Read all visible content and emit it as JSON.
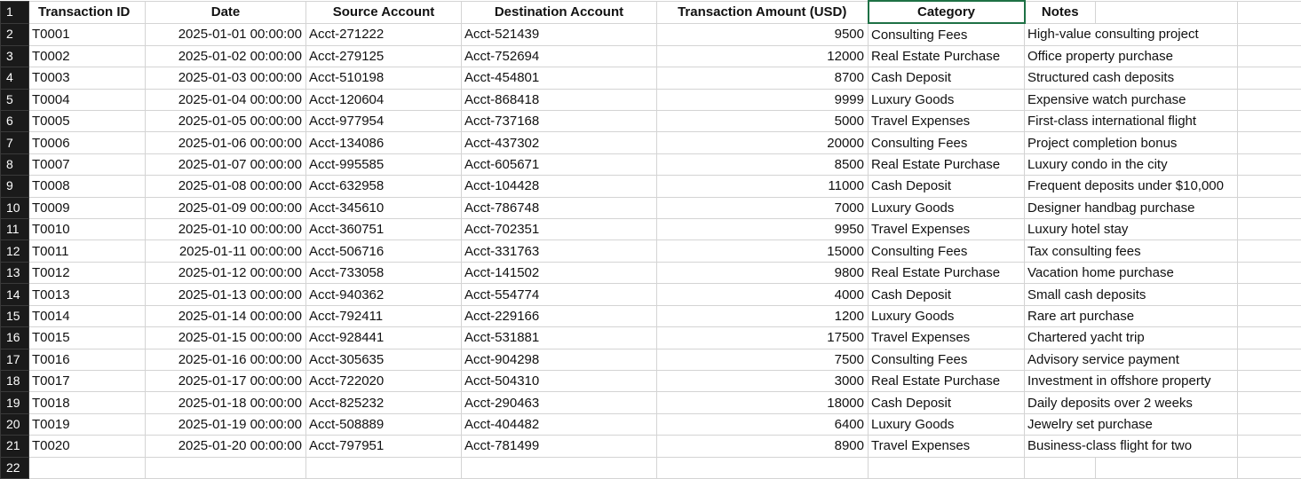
{
  "headers": [
    "Transaction ID",
    "Date",
    "Source Account",
    "Destination Account",
    "Transaction Amount (USD)",
    "Category",
    "Notes"
  ],
  "rows": [
    [
      "T0001",
      "2025-01-01 00:00:00",
      "Acct-271222",
      "Acct-521439",
      "9500",
      "Consulting Fees",
      "High-value consulting project"
    ],
    [
      "T0002",
      "2025-01-02 00:00:00",
      "Acct-279125",
      "Acct-752694",
      "12000",
      "Real Estate Purchase",
      "Office property purchase"
    ],
    [
      "T0003",
      "2025-01-03 00:00:00",
      "Acct-510198",
      "Acct-454801",
      "8700",
      "Cash Deposit",
      "Structured cash deposits"
    ],
    [
      "T0004",
      "2025-01-04 00:00:00",
      "Acct-120604",
      "Acct-868418",
      "9999",
      "Luxury Goods",
      "Expensive watch purchase"
    ],
    [
      "T0005",
      "2025-01-05 00:00:00",
      "Acct-977954",
      "Acct-737168",
      "5000",
      "Travel Expenses",
      "First-class international flight"
    ],
    [
      "T0006",
      "2025-01-06 00:00:00",
      "Acct-134086",
      "Acct-437302",
      "20000",
      "Consulting Fees",
      "Project completion bonus"
    ],
    [
      "T0007",
      "2025-01-07 00:00:00",
      "Acct-995585",
      "Acct-605671",
      "8500",
      "Real Estate Purchase",
      "Luxury condo in the city"
    ],
    [
      "T0008",
      "2025-01-08 00:00:00",
      "Acct-632958",
      "Acct-104428",
      "11000",
      "Cash Deposit",
      "Frequent deposits under $10,000"
    ],
    [
      "T0009",
      "2025-01-09 00:00:00",
      "Acct-345610",
      "Acct-786748",
      "7000",
      "Luxury Goods",
      "Designer handbag purchase"
    ],
    [
      "T0010",
      "2025-01-10 00:00:00",
      "Acct-360751",
      "Acct-702351",
      "9950",
      "Travel Expenses",
      "Luxury hotel stay"
    ],
    [
      "T0011",
      "2025-01-11 00:00:00",
      "Acct-506716",
      "Acct-331763",
      "15000",
      "Consulting Fees",
      "Tax consulting fees"
    ],
    [
      "T0012",
      "2025-01-12 00:00:00",
      "Acct-733058",
      "Acct-141502",
      "9800",
      "Real Estate Purchase",
      "Vacation home purchase"
    ],
    [
      "T0013",
      "2025-01-13 00:00:00",
      "Acct-940362",
      "Acct-554774",
      "4000",
      "Cash Deposit",
      "Small cash deposits"
    ],
    [
      "T0014",
      "2025-01-14 00:00:00",
      "Acct-792411",
      "Acct-229166",
      "1200",
      "Luxury Goods",
      "Rare art purchase"
    ],
    [
      "T0015",
      "2025-01-15 00:00:00",
      "Acct-928441",
      "Acct-531881",
      "17500",
      "Travel Expenses",
      "Chartered yacht trip"
    ],
    [
      "T0016",
      "2025-01-16 00:00:00",
      "Acct-305635",
      "Acct-904298",
      "7500",
      "Consulting Fees",
      "Advisory service payment"
    ],
    [
      "T0017",
      "2025-01-17 00:00:00",
      "Acct-722020",
      "Acct-504310",
      "3000",
      "Real Estate Purchase",
      "Investment in offshore property"
    ],
    [
      "T0018",
      "2025-01-18 00:00:00",
      "Acct-825232",
      "Acct-290463",
      "18000",
      "Cash Deposit",
      "Daily deposits over 2 weeks"
    ],
    [
      "T0019",
      "2025-01-19 00:00:00",
      "Acct-508889",
      "Acct-404482",
      "6400",
      "Luxury Goods",
      "Jewelry set purchase"
    ],
    [
      "T0020",
      "2025-01-20 00:00:00",
      "Acct-797951",
      "Acct-781499",
      "8900",
      "Travel Expenses",
      "Business-class flight for two"
    ]
  ],
  "row_numbers": [
    "1",
    "2",
    "3",
    "4",
    "5",
    "6",
    "7",
    "8",
    "9",
    "10",
    "11",
    "12",
    "13",
    "14",
    "15",
    "16",
    "17",
    "18",
    "19",
    "20",
    "21",
    "22"
  ]
}
